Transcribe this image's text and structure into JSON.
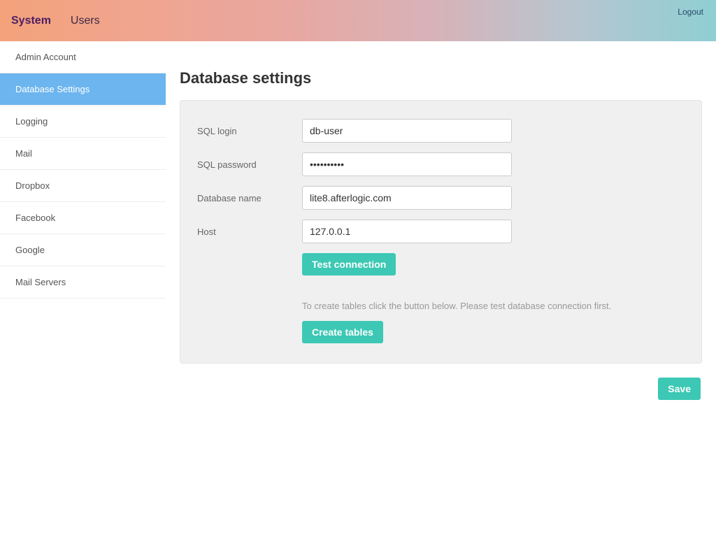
{
  "topbar": {
    "system": "System",
    "users": "Users",
    "logout": "Logout"
  },
  "sidebar": {
    "items": [
      {
        "label": "Admin Account"
      },
      {
        "label": "Database Settings"
      },
      {
        "label": "Logging"
      },
      {
        "label": "Mail"
      },
      {
        "label": "Dropbox"
      },
      {
        "label": "Facebook"
      },
      {
        "label": "Google"
      },
      {
        "label": "Mail Servers"
      }
    ]
  },
  "main": {
    "title": "Database settings",
    "labels": {
      "sql_login": "SQL login",
      "sql_password": "SQL password",
      "db_name": "Database name",
      "host": "Host"
    },
    "values": {
      "sql_login": "db-user",
      "sql_password": "••••••••••",
      "db_name": "lite8.afterlogic.com",
      "host": "127.0.0.1"
    },
    "buttons": {
      "test_connection": "Test connection",
      "create_tables": "Create tables",
      "save": "Save"
    },
    "helper": "To create tables click the button below. Please test database connection first."
  }
}
